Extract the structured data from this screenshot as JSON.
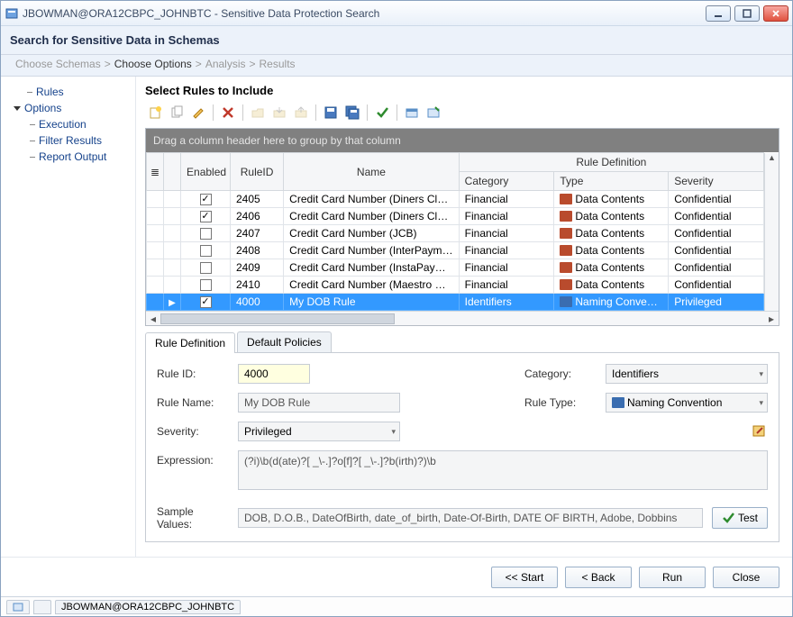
{
  "window": {
    "title": "JBOWMAN@ORA12CBPC_JOHNBTC - Sensitive Data Protection Search"
  },
  "header": {
    "title": "Search for Sensitive Data in Schemas"
  },
  "breadcrumb": {
    "step1": "Choose Schemas",
    "step2": "Choose Options",
    "step3": "Analysis",
    "step4": "Results",
    "sep": ">"
  },
  "sidebar": {
    "rules": "Rules",
    "options": "Options",
    "execution": "Execution",
    "filter_results": "Filter Results",
    "report_output": "Report Output"
  },
  "content": {
    "heading": "Select Rules to Include",
    "group_hint": "Drag a column header here to group by that column",
    "super_header": "Rule Definition",
    "columns": {
      "enabled": "Enabled",
      "ruleid": "RuleID",
      "name": "Name",
      "category": "Category",
      "type": "Type",
      "severity": "Severity"
    },
    "rows": [
      {
        "enabled": true,
        "ruleid": "2405",
        "name": "Credit Card Number (Diners Club - ...",
        "category": "Financial",
        "type": "Data Contents",
        "typeKind": "data",
        "severity": "Confidential",
        "selected": false
      },
      {
        "enabled": true,
        "ruleid": "2406",
        "name": "Credit Card Number (Diners Club - ...",
        "category": "Financial",
        "type": "Data Contents",
        "typeKind": "data",
        "severity": "Confidential",
        "selected": false
      },
      {
        "enabled": false,
        "ruleid": "2407",
        "name": "Credit Card Number (JCB)",
        "category": "Financial",
        "type": "Data Contents",
        "typeKind": "data",
        "severity": "Confidential",
        "selected": false
      },
      {
        "enabled": false,
        "ruleid": "2408",
        "name": "Credit Card Number (InterPayment)",
        "category": "Financial",
        "type": "Data Contents",
        "typeKind": "data",
        "severity": "Confidential",
        "selected": false
      },
      {
        "enabled": false,
        "ruleid": "2409",
        "name": "Credit Card Number (InstaPayment)",
        "category": "Financial",
        "type": "Data Contents",
        "typeKind": "data",
        "severity": "Confidential",
        "selected": false
      },
      {
        "enabled": false,
        "ruleid": "2410",
        "name": "Credit Card Number (Maestro Debit)",
        "category": "Financial",
        "type": "Data Contents",
        "typeKind": "data",
        "severity": "Confidential",
        "selected": false
      },
      {
        "enabled": true,
        "ruleid": "4000",
        "name": "My DOB Rule",
        "category": "Identifiers",
        "type": "Naming Convention",
        "typeKind": "naming",
        "severity": "Privileged",
        "selected": true
      }
    ]
  },
  "tabs": {
    "rule_def": "Rule Definition",
    "default_policies": "Default Policies"
  },
  "form": {
    "ruleid_label": "Rule ID:",
    "ruleid_value": "4000",
    "rulename_label": "Rule Name:",
    "rulename_value": "My DOB Rule",
    "severity_label": "Severity:",
    "severity_value": "Privileged",
    "category_label": "Category:",
    "category_value": "Identifiers",
    "ruletype_label": "Rule Type:",
    "ruletype_value": "Naming Convention",
    "expression_label": "Expression:",
    "expression_value": "(?i)\\b(d(ate)?[ _\\-.]?o[f]?[ _\\-.]?b(irth)?)\\b",
    "sample_label": "Sample Values:",
    "sample_value": "DOB, D.O.B., DateOfBirth, date_of_birth, Date-Of-Birth, DATE OF BIRTH, Adobe, Dobbins",
    "test_label": "Test"
  },
  "footer": {
    "start": "<< Start",
    "back": "< Back",
    "run": "Run",
    "close": "Close"
  },
  "statusbar": {
    "tab_label": "JBOWMAN@ORA12CBPC_JOHNBTC"
  }
}
